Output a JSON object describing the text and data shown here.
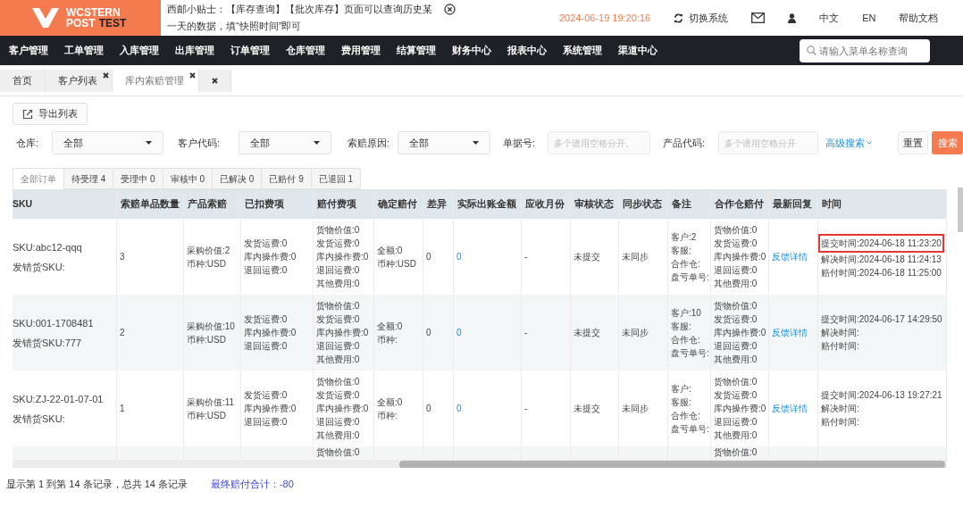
{
  "logo": {
    "line1": "WCSTERN",
    "line2a": "POST",
    "line2b": "TEST"
  },
  "notice": {
    "text": "西邮小贴士：【库存查询】【批次库存】页面可以查询历史某一天的数据，填“快照时间”即可"
  },
  "clock": "2024-06-19 19:20:16",
  "header_links": [
    {
      "kind": "switch",
      "label": "切换系统"
    },
    {
      "kind": "mail"
    },
    {
      "kind": "user"
    },
    {
      "kind": "text",
      "label": "中文"
    },
    {
      "kind": "text",
      "label": "EN"
    },
    {
      "kind": "text",
      "label": "帮助文档"
    }
  ],
  "nav": [
    "客户管理",
    "工单管理",
    "入库管理",
    "出库管理",
    "订单管理",
    "仓库管理",
    "费用管理",
    "结算管理",
    "财务中心",
    "报表中心",
    "系统管理",
    "渠道中心"
  ],
  "menu_search": {
    "placeholder": "请输入菜单名称查询"
  },
  "page_tabs": [
    {
      "label": "首页",
      "selected": false,
      "closable": false
    },
    {
      "label": "客户列表",
      "selected": false,
      "closable": true
    },
    {
      "label": "库内索赔管理",
      "selected": true,
      "closable": true
    },
    {
      "selected": false,
      "closable": true
    }
  ],
  "export_button": "导出列表",
  "filters": [
    {
      "kind": "select",
      "label": "仓库:",
      "value": "全部"
    },
    {
      "kind": "select",
      "label": "客户代码:",
      "value": "全部"
    },
    {
      "kind": "select",
      "label": "索赔原因:",
      "value": "全部"
    },
    {
      "kind": "input",
      "label": "单据号:",
      "placeholder": "多个请用空格分开。"
    },
    {
      "kind": "input",
      "label": "产品代码:",
      "placeholder": "多个请用空格分开"
    }
  ],
  "advanced_search": "高级搜索",
  "reset_button": "重置",
  "search_button": "搜索",
  "status_tabs": [
    {
      "label": "全部订单",
      "selected": true
    },
    {
      "label": "待受理 4",
      "selected": false
    },
    {
      "label": "受理中 0",
      "selected": false
    },
    {
      "label": "审核中 0",
      "selected": false
    },
    {
      "label": "已解决 0",
      "selected": false
    },
    {
      "label": "已赔付 9",
      "selected": false
    },
    {
      "label": "已退回 1",
      "selected": false
    }
  ],
  "table": {
    "columns": [
      "SKU",
      "索赔单品数量",
      "产品索赔",
      "已扣费项",
      "赔付费项",
      "确定赔付",
      "差异",
      "实际出账金额",
      "应收月份",
      "审核状态",
      "同步状态",
      "备注",
      "合作仓赔付",
      "最新回复",
      "时间"
    ],
    "rows": [
      {
        "cells": [
          [
            "SKU:abc12-qqq",
            "发错货SKU:"
          ],
          [
            "3"
          ],
          [
            "采购价值:2",
            "币种:USD"
          ],
          [
            "发货运费:0",
            "库内操作费:0",
            "退回运费:0"
          ],
          [
            "货物价值:0",
            "发货运费:0",
            "库内操作费:0",
            "退回运费:0",
            "其他费用:0"
          ],
          [
            "全额:0",
            "币种:USD"
          ],
          [
            "0"
          ],
          [
            "0"
          ],
          [
            "-"
          ],
          [
            "未提交"
          ],
          [
            "未同步"
          ],
          [
            "客户:2",
            "客服:",
            "合作仓:",
            "盘亏单号:"
          ],
          [
            "货物价值:0",
            "发货运费:0",
            "库内操作费:0",
            "退回运费:0",
            "其他费用:0"
          ],
          [
            "反馈详情"
          ],
          [
            "提交时间:2024-06-18 11:23:20",
            "解决时间:2024-06-18 11:24:13",
            "赔付时间:2024-06-18 11:25:00"
          ]
        ],
        "highlighted": true
      },
      {
        "cells": [
          [
            "SKU:001-1708481",
            "发错货SKU:777"
          ],
          [
            "2"
          ],
          [
            "采购价值:10",
            "币种:USD"
          ],
          [
            "发货运费:0",
            "库内操作费:0",
            "退回运费:0"
          ],
          [
            "货物价值:0",
            "发货运费:0",
            "库内操作费:0",
            "退回运费:0",
            "其他费用:0"
          ],
          [
            "全额:0",
            "币种:"
          ],
          [
            "0"
          ],
          [
            "0"
          ],
          [
            "-"
          ],
          [
            "未提交"
          ],
          [
            "未同步"
          ],
          [
            "客户:10",
            "客服:",
            "合作仓:",
            "盘亏单号:"
          ],
          [
            "货物价值:0",
            "发货运费:0",
            "库内操作费:0",
            "退回运费:0",
            "其他费用:0"
          ],
          [
            "反馈详情"
          ],
          [
            "提交时间:2024-06-17 14:29:50",
            "解决时间:",
            "赔付时间:"
          ]
        ],
        "highlighted": false
      },
      {
        "cells": [
          [
            "SKU:ZJ-22-01-07-01",
            "发错货SKU:"
          ],
          [
            "1"
          ],
          [
            "采购价值:11",
            "币种:USD"
          ],
          [
            "发货运费:0",
            "库内操作费:0",
            "退回运费:0"
          ],
          [
            "货物价值:0",
            "发货运费:0",
            "库内操作费:0",
            "退回运费:0",
            "其他费用:0"
          ],
          [
            "全额:0",
            "币种:"
          ],
          [
            "0"
          ],
          [
            "0"
          ],
          [
            "-"
          ],
          [
            "未提交"
          ],
          [
            "未同步"
          ],
          [
            "客户:",
            "客服:",
            "合作仓:",
            "盘亏单号:"
          ],
          [
            "货物价值:0",
            "发货运费:0",
            "库内操作费:0",
            "退回运费:0",
            "其他费用:0"
          ],
          [
            "反馈详情"
          ],
          [
            "提交时间:2024-06-13 19:27:21",
            "解决时间:",
            "赔付时间:"
          ]
        ],
        "highlighted": false
      },
      {
        "cells": [
          [],
          [],
          [],
          [],
          [
            "货物价值:0"
          ],
          [],
          [],
          [],
          [],
          [],
          [],
          [],
          [
            "货物价值:0"
          ],
          [],
          []
        ],
        "highlighted": false
      }
    ]
  },
  "footer": {
    "summary": "显示第 1 到第 14 条记录，总共 14 条记录",
    "total": "最终赔付合计：-80"
  }
}
